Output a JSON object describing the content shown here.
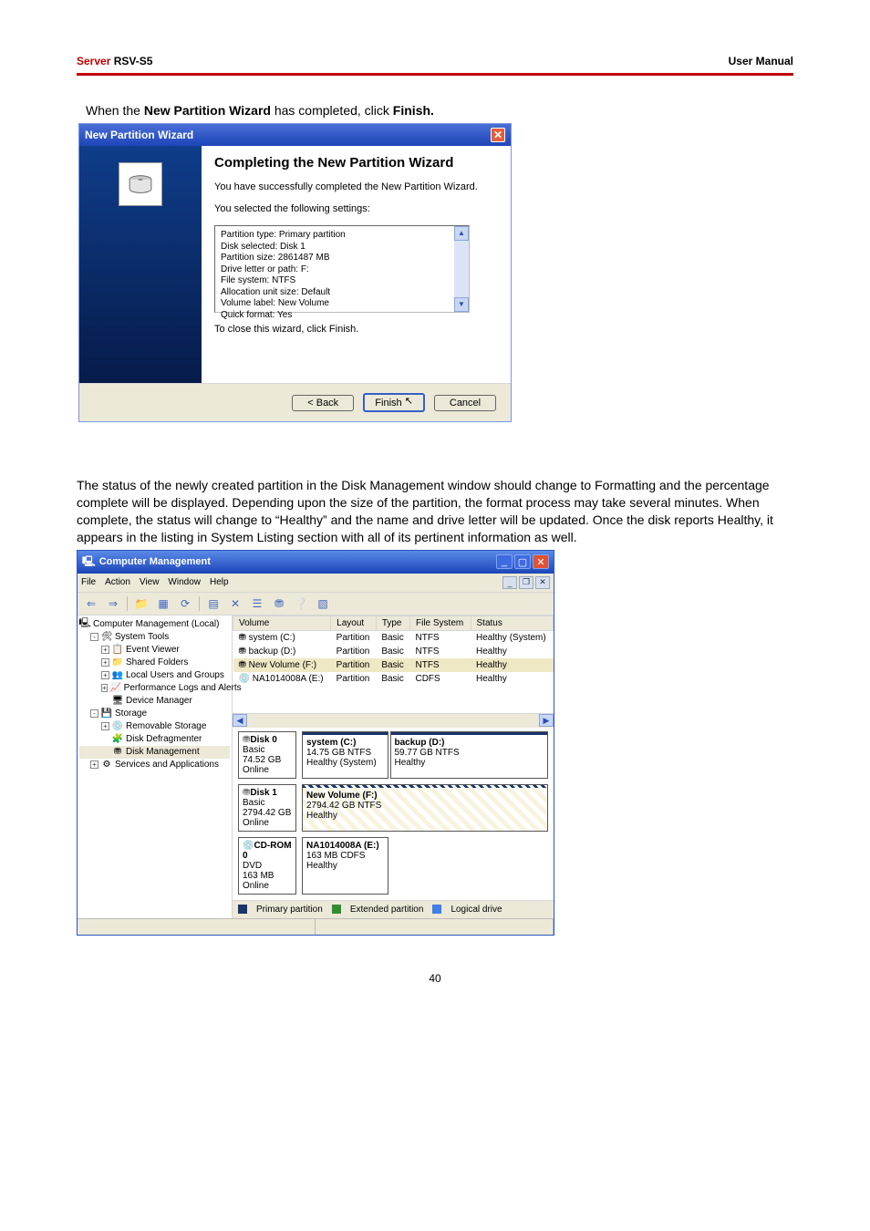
{
  "header": {
    "server_label": "Server",
    "model": "RSV-S5",
    "right": "User Manual"
  },
  "instruction": {
    "pre": "When the ",
    "bold1": "New Partition Wizard",
    "mid": " has completed, click ",
    "bold2": "Finish."
  },
  "wizard": {
    "title": "New Partition Wizard",
    "heading": "Completing the New Partition Wizard",
    "success": "You have successfully completed the New Partition Wizard.",
    "selected": "You selected the following settings:",
    "settings": [
      "Partition type: Primary partition",
      "Disk selected: Disk 1",
      "Partition size: 2861487 MB",
      "Drive letter or path: F:",
      "File system: NTFS",
      "Allocation unit size: Default",
      "Volume label: New Volume",
      "Quick format: Yes"
    ],
    "close_hint": "To close this wizard, click Finish.",
    "buttons": {
      "back": "< Back",
      "finish": "Finish",
      "cancel": "Cancel"
    }
  },
  "paragraph": "The status of the newly created partition in the Disk Management window should change to Formatting and the percentage complete will be displayed. Depending upon the size of the partition, the format process may take several minutes. When complete, the status will change to “Healthy”  and the name and drive letter will be updated. Once the disk reports Healthy, it appears in the listing in System Listing section with all of its pertinent information as well.",
  "cm": {
    "title": "Computer Management",
    "menubar": [
      "File",
      "Action",
      "View",
      "Window",
      "Help"
    ],
    "tree": {
      "root": "Computer Management (Local)",
      "system_tools": "System Tools",
      "items_st": [
        "Event Viewer",
        "Shared Folders",
        "Local Users and Groups",
        "Performance Logs and Alerts",
        "Device Manager"
      ],
      "storage": "Storage",
      "items_storage": [
        "Removable Storage",
        "Disk Defragmenter",
        "Disk Management"
      ],
      "services": "Services and Applications"
    },
    "table": {
      "headers": [
        "Volume",
        "Layout",
        "Type",
        "File System",
        "Status"
      ],
      "rows": [
        {
          "volume": "system (C:)",
          "layout": "Partition",
          "type": "Basic",
          "fs": "NTFS",
          "status": "Healthy (System)"
        },
        {
          "volume": "backup (D:)",
          "layout": "Partition",
          "type": "Basic",
          "fs": "NTFS",
          "status": "Healthy"
        },
        {
          "volume": "New Volume (F:)",
          "layout": "Partition",
          "type": "Basic",
          "fs": "NTFS",
          "status": "Healthy",
          "selected": true
        },
        {
          "volume": "NA1014008A (E:)",
          "layout": "Partition",
          "type": "Basic",
          "fs": "CDFS",
          "status": "Healthy"
        }
      ]
    },
    "disks": [
      {
        "head": {
          "name": "Disk 0",
          "type": "Basic",
          "size": "74.52 GB",
          "state": "Online"
        },
        "parts": [
          {
            "name": "system (C:)",
            "desc": "14.75 GB NTFS",
            "status": "Healthy (System)",
            "stripe": "navy"
          },
          {
            "name": "backup (D:)",
            "desc": "59.77 GB NTFS",
            "status": "Healthy",
            "stripe": "navy"
          }
        ]
      },
      {
        "head": {
          "name": "Disk 1",
          "type": "Basic",
          "size": "2794.42 GB",
          "state": "Online"
        },
        "parts": [
          {
            "name": "New Volume (F:)",
            "desc": "2794.42 GB NTFS",
            "status": "Healthy",
            "stripe": "hatch"
          }
        ]
      },
      {
        "head": {
          "name": "CD-ROM 0",
          "type": "DVD",
          "size": "163 MB",
          "state": "Online"
        },
        "parts": [
          {
            "name": "NA1014008A (E:)",
            "desc": "163 MB CDFS",
            "status": "Healthy",
            "stripe": "none",
            "narrow": true
          }
        ]
      }
    ],
    "legend": {
      "primary": "Primary partition",
      "extended": "Extended partition",
      "logical": "Logical drive"
    }
  },
  "page_number": "40"
}
